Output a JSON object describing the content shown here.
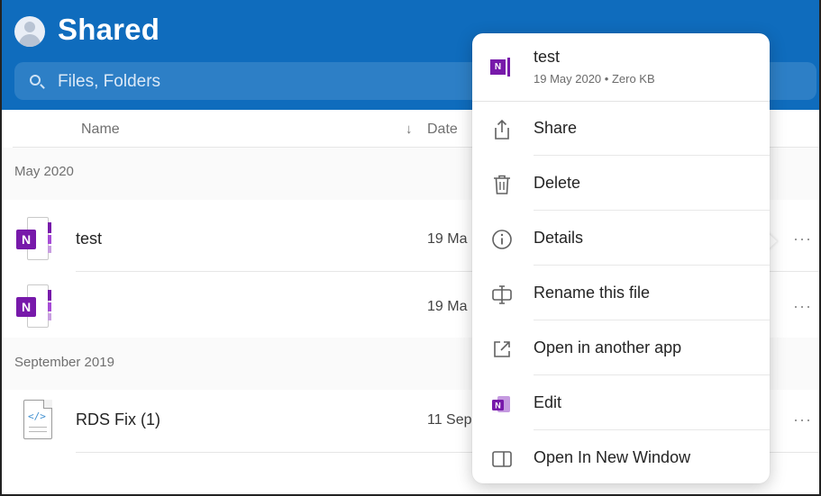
{
  "header": {
    "title": "Shared",
    "search_placeholder": "Files, Folders"
  },
  "columns": {
    "name": "Name",
    "sort_arrow": "↓",
    "date": "Date"
  },
  "sections": [
    {
      "label": "May 2020",
      "rows": [
        {
          "name": "test",
          "date": "19 Ma",
          "icon": "onenote-icon",
          "more": "···"
        },
        {
          "name": "",
          "date": "19 Ma",
          "icon": "onenote-icon",
          "more": "···"
        }
      ]
    },
    {
      "label": "September 2019",
      "rows": [
        {
          "name": "RDS Fix (1)",
          "date": "11 Sep",
          "icon": "code-file-icon",
          "more": "···"
        }
      ]
    }
  ],
  "icon_badges": {
    "onenote": "N",
    "code": "</>"
  },
  "context_menu": {
    "file_title": "test",
    "file_subtitle": "19 May 2020 • Zero KB",
    "items": [
      {
        "label": "Share",
        "icon": "share-icon"
      },
      {
        "label": "Delete",
        "icon": "trash-icon"
      },
      {
        "label": "Details",
        "icon": "info-icon"
      },
      {
        "label": "Rename this file",
        "icon": "rename-icon"
      },
      {
        "label": "Open in another app",
        "icon": "open-external-icon"
      },
      {
        "label": "Edit",
        "icon": "onenote-edit-icon"
      },
      {
        "label": "Open In New Window",
        "icon": "new-window-icon"
      }
    ]
  },
  "colors": {
    "header_blue": "#0f6cbd",
    "onenote_purple": "#7719aa"
  }
}
